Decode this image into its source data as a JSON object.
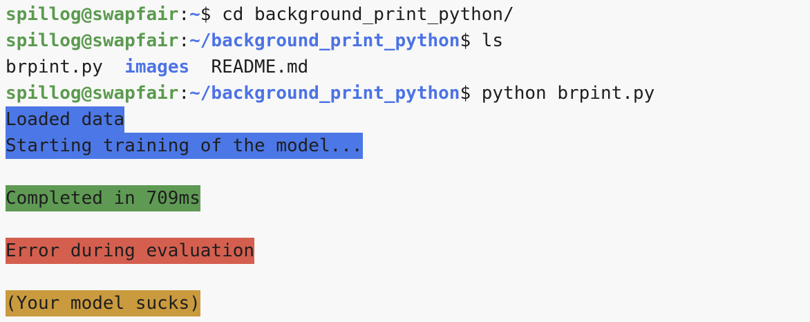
{
  "prompt": {
    "user_host": "spillog@swapfair",
    "colon": ":",
    "dollar": "$ "
  },
  "lines": [
    {
      "path": "~",
      "command": "cd background_print_python/"
    },
    {
      "path": "~/background_print_python",
      "command": "ls"
    },
    {
      "ls_items": [
        "brpint.py",
        "images",
        "README.md"
      ]
    },
    {
      "path": "~/background_print_python",
      "command": "python brpint.py"
    }
  ],
  "output": {
    "loaded": "Loaded data",
    "starting": "Starting training of the model...",
    "completed": "Completed in 709ms",
    "error": "Error during evaluation",
    "sucks": "(Your model sucks)"
  },
  "colors": {
    "blue_highlight": "#4c77e6",
    "green_highlight": "#5f9a54",
    "red_highlight": "#d45f4f",
    "yellow_highlight": "#c99a3e",
    "prompt_user": "#5b9a4f",
    "prompt_path": "#4c73e4"
  }
}
